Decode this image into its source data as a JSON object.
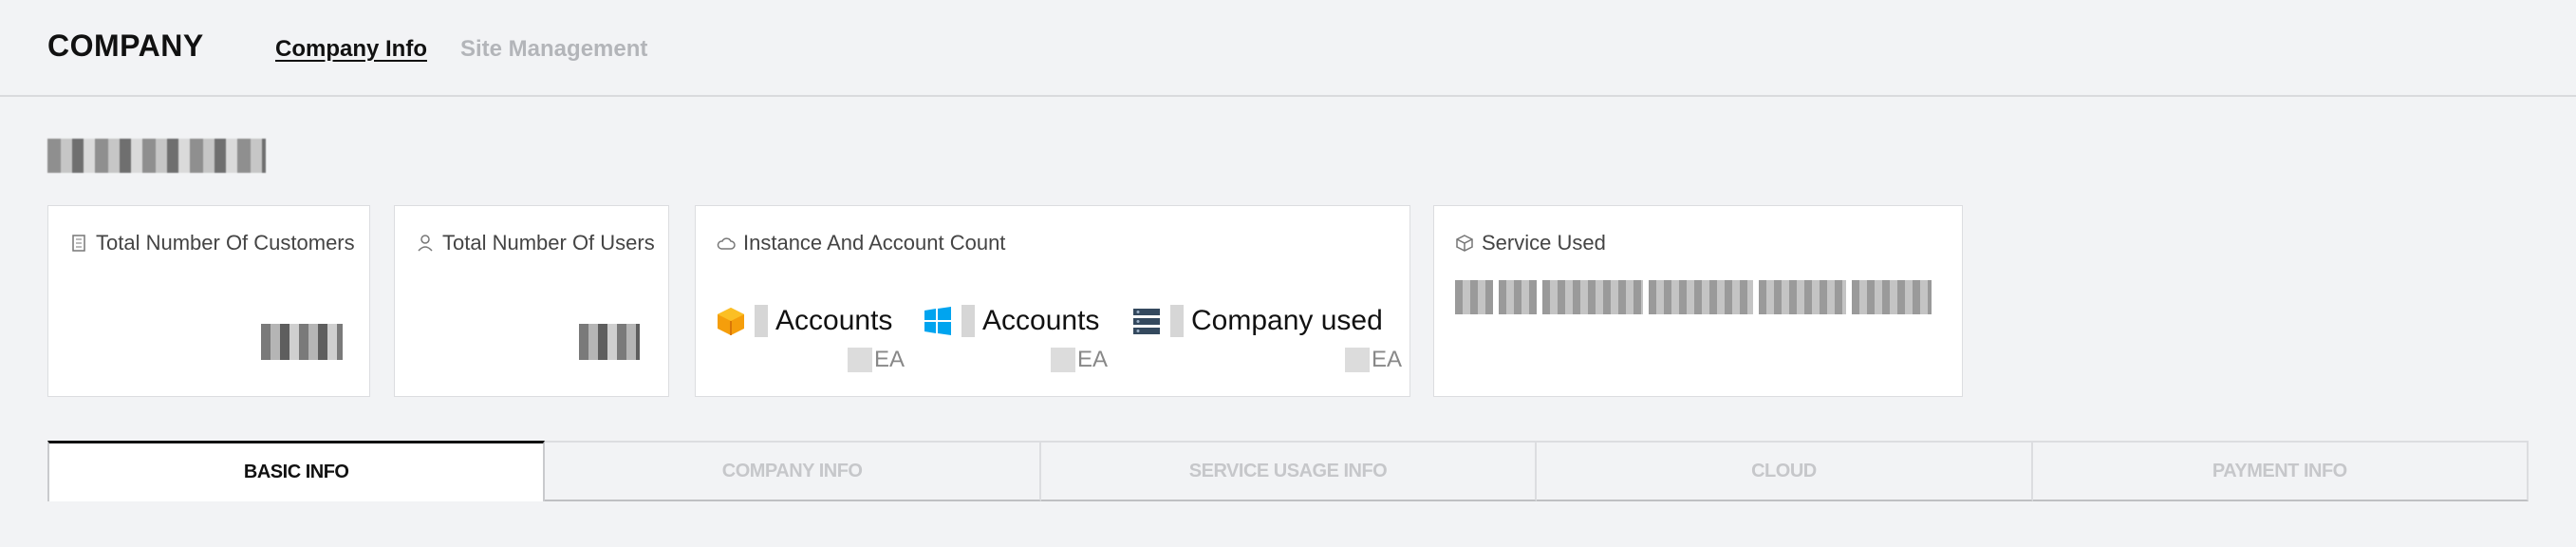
{
  "header": {
    "brand": "COMPANY",
    "nav": [
      {
        "label": "Company Info",
        "active": true
      },
      {
        "label": "Site Management",
        "active": false
      }
    ]
  },
  "cards": {
    "customers": {
      "title": "Total Number Of Customers",
      "icon": "building-icon"
    },
    "users": {
      "title": "Total Number Of Users",
      "icon": "user-icon"
    },
    "instances": {
      "title": "Instance And Account Count",
      "icon": "cloud-icon",
      "items": [
        {
          "label": "Accounts",
          "unit": "EA",
          "icon": "aws-box-icon",
          "color": "#f59e0b"
        },
        {
          "label": "Accounts",
          "unit": "EA",
          "icon": "windows-icon",
          "color": "#00a4ef"
        },
        {
          "label": "Company used",
          "unit": "EA",
          "icon": "server-icon",
          "color": "#34495e"
        }
      ]
    },
    "service": {
      "title": "Service Used",
      "icon": "package-icon"
    }
  },
  "tabs": [
    {
      "label": "BASIC INFO",
      "active": true
    },
    {
      "label": "COMPANY INFO",
      "active": false
    },
    {
      "label": "SERVICE USAGE INFO",
      "active": false
    },
    {
      "label": "CLOUD",
      "active": false
    },
    {
      "label": "PAYMENT INFO",
      "active": false
    }
  ]
}
